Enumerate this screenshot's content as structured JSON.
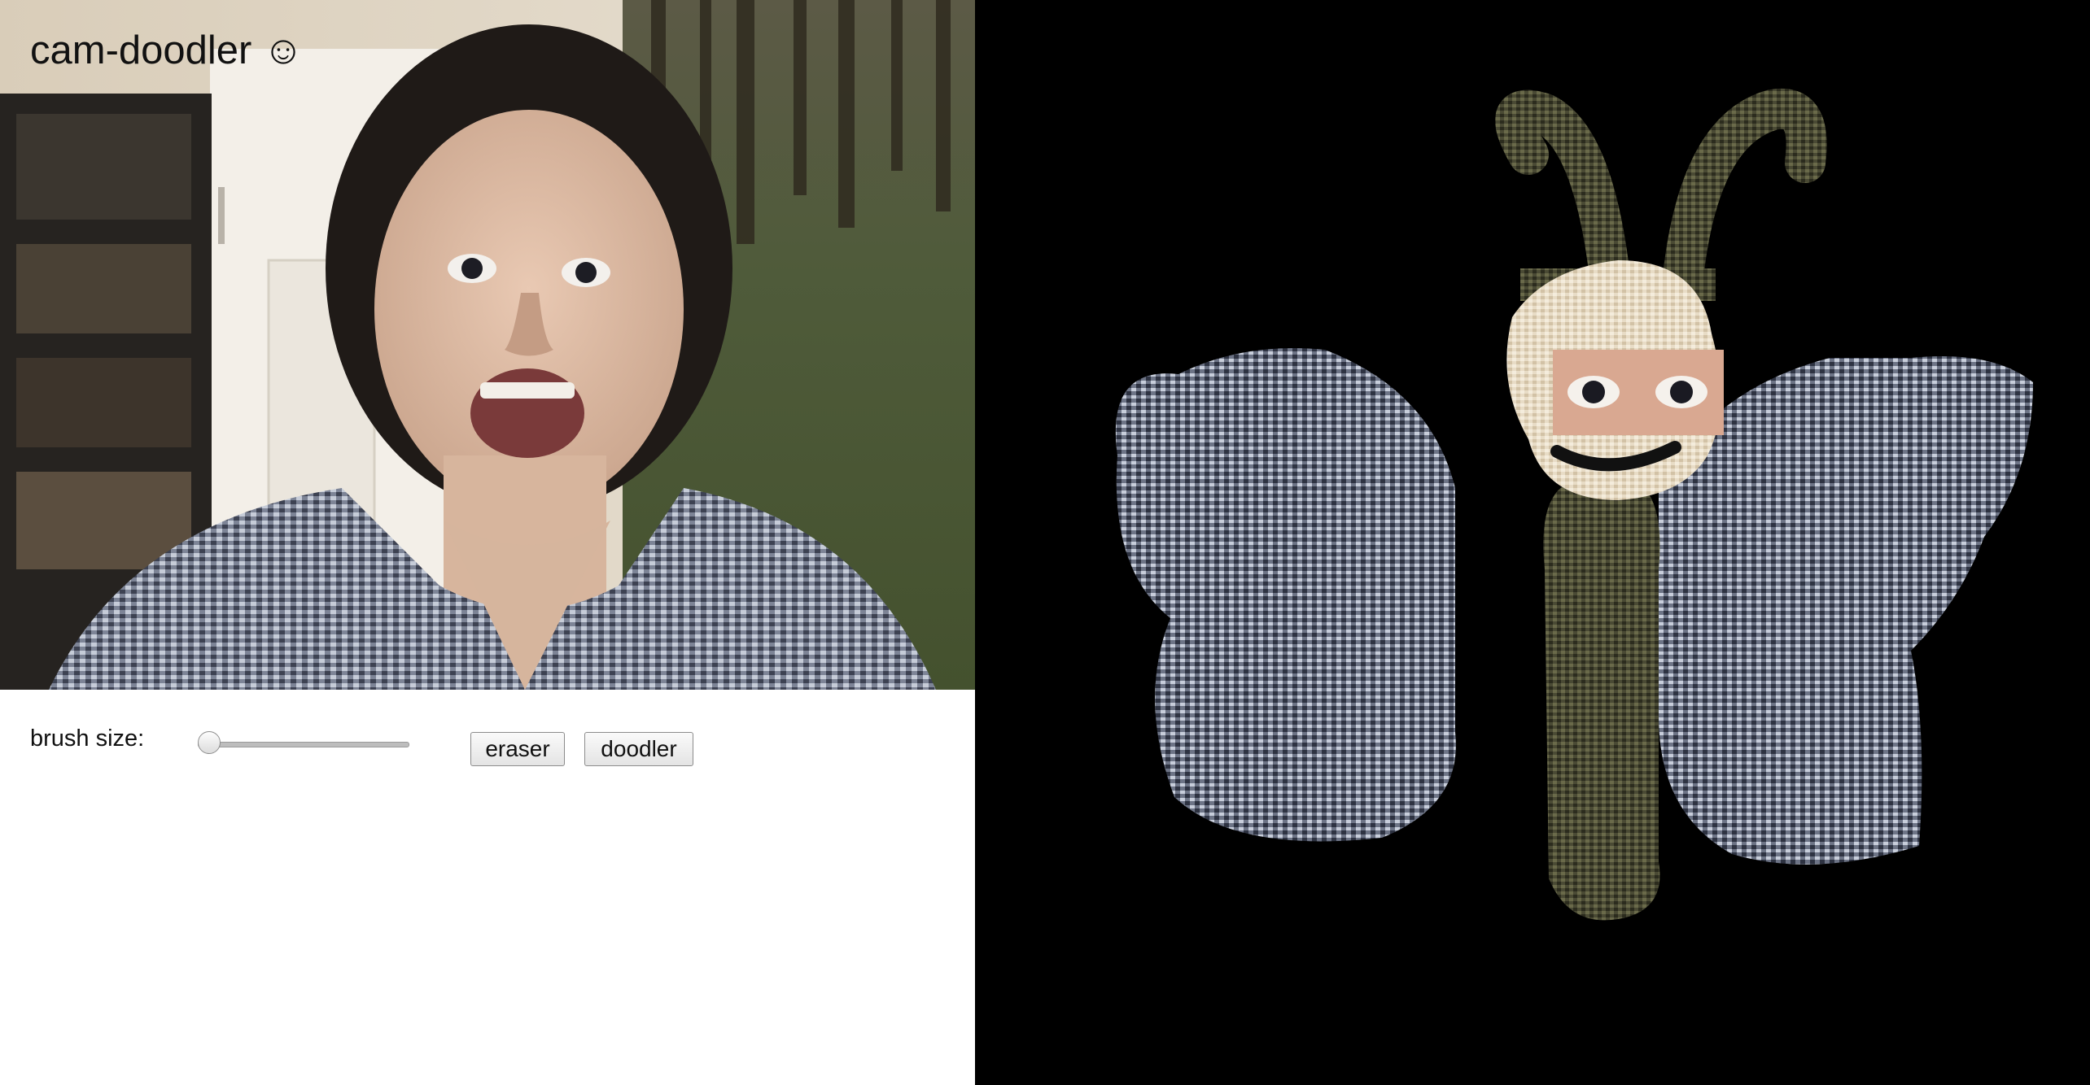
{
  "app": {
    "title": "cam-doodler ☺"
  },
  "controls": {
    "brush_size_label": "brush size:",
    "brush_size_value": 0,
    "eraser_label": "eraser",
    "doodler_label": "doodler"
  },
  "canvas": {
    "background": "#000000",
    "doodle_subject": "butterfly"
  },
  "colors": {
    "accent_wing": "#8a93a8",
    "accent_body": "#4a4a34",
    "accent_face": "#e8dcc6"
  }
}
